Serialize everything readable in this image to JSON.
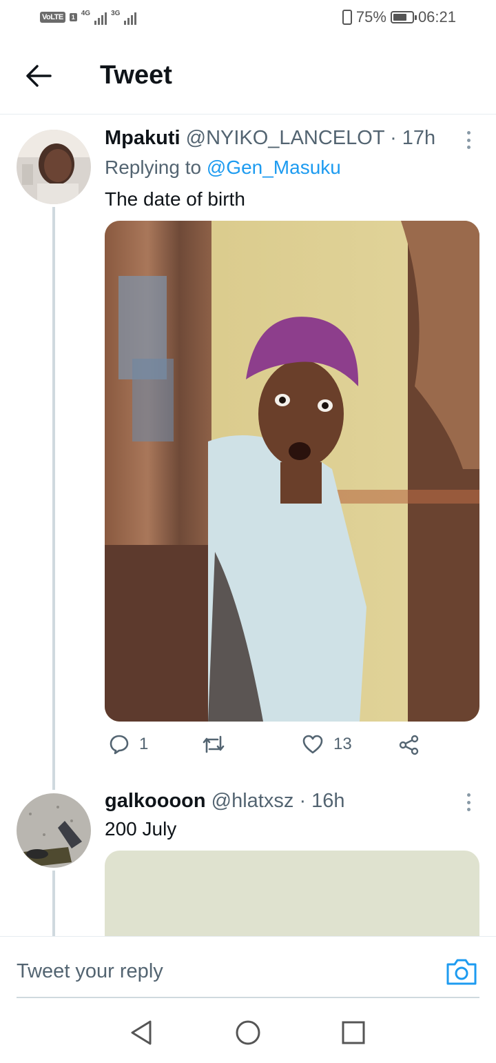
{
  "status_bar": {
    "volte": "VoLTE",
    "sim": "1",
    "net1": "4G",
    "net2": "3G",
    "battery": "75%",
    "time": "06:21"
  },
  "header": {
    "title": "Tweet",
    "back_icon": "arrow-left-icon"
  },
  "tweets": [
    {
      "name": "Mpakuti",
      "handle": "@NYIKO_LANCELOT",
      "time": "· 17h",
      "replying_prefix": "Replying to",
      "replying_to": "@Gen_Masuku",
      "text": "The date of birth",
      "actions": {
        "reply_count": "1",
        "retweet_count": "",
        "like_count": "13"
      }
    },
    {
      "name": "galkoooon",
      "handle": "@hlatxsz",
      "time": "· 16h",
      "text": "200 July"
    }
  ],
  "reply_bar": {
    "placeholder": "Tweet your reply",
    "camera_icon": "camera-icon"
  },
  "colors": {
    "accent": "#1d9bf0",
    "secondary_text": "#536471",
    "thread_line": "#cfd9de"
  }
}
